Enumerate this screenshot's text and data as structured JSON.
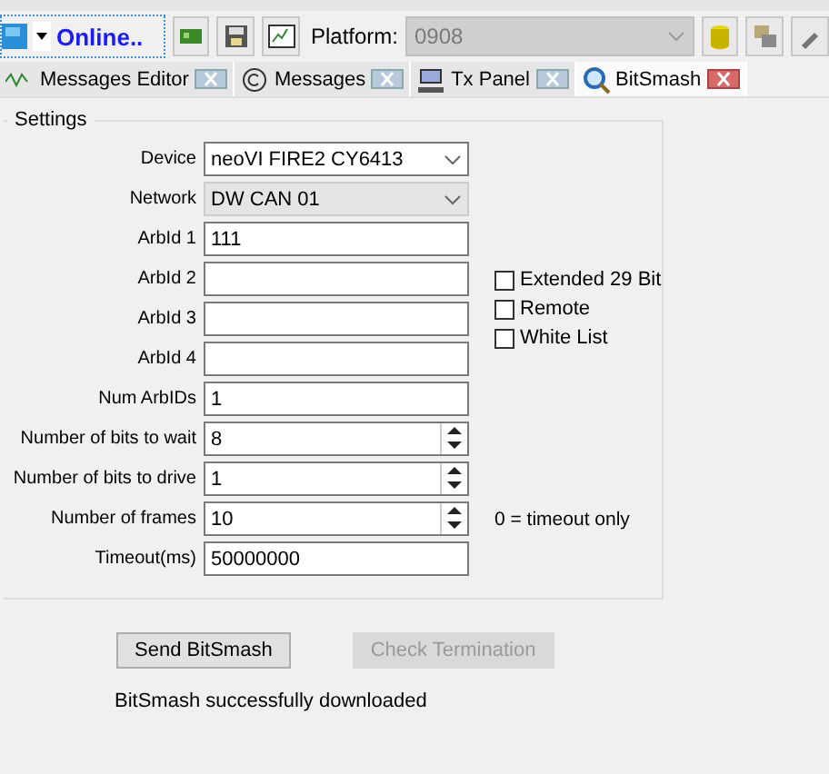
{
  "toolbar": {
    "status": "Online..",
    "platform_label": "Platform:",
    "platform_value": "0908"
  },
  "tabs": [
    {
      "label": "Messages Editor",
      "selected": false
    },
    {
      "label": "Messages",
      "selected": false
    },
    {
      "label": "Tx Panel",
      "selected": false
    },
    {
      "label": "BitSmash",
      "selected": true
    }
  ],
  "settings": {
    "title": "Settings",
    "fields": [
      {
        "kind": "combo",
        "label": "Device",
        "value": "neoVI FIRE2 CY6413",
        "disabled": false
      },
      {
        "kind": "combo",
        "label": "Network",
        "value": "DW CAN 01",
        "disabled": true
      },
      {
        "kind": "text",
        "label": "ArbId 1",
        "value": "111"
      },
      {
        "kind": "text",
        "label": "ArbId 2"
      },
      {
        "kind": "text",
        "label": "ArbId 3"
      },
      {
        "kind": "text",
        "label": "ArbId 4"
      },
      {
        "kind": "text",
        "label": "Num ArbIDs",
        "value": "1"
      },
      {
        "kind": "spin",
        "label": "Number of bits to wait",
        "value": "8"
      },
      {
        "kind": "spin",
        "label": "Number of bits to drive",
        "value": "1"
      },
      {
        "kind": "spin",
        "label": "Number of frames",
        "value": "10",
        "note": "0 = timeout only"
      },
      {
        "kind": "text",
        "label": "Timeout(ms)",
        "value": "50000000"
      }
    ],
    "options": [
      {
        "label": "Extended 29 Bit",
        "checked": false
      },
      {
        "label": "Remote",
        "checked": false
      },
      {
        "label": "White List",
        "checked": false
      }
    ]
  },
  "buttons": [
    {
      "label": "Send BitSmash",
      "disabled": false
    },
    {
      "label": "Check Termination",
      "disabled": true
    }
  ],
  "status": "BitSmash successfully downloaded"
}
